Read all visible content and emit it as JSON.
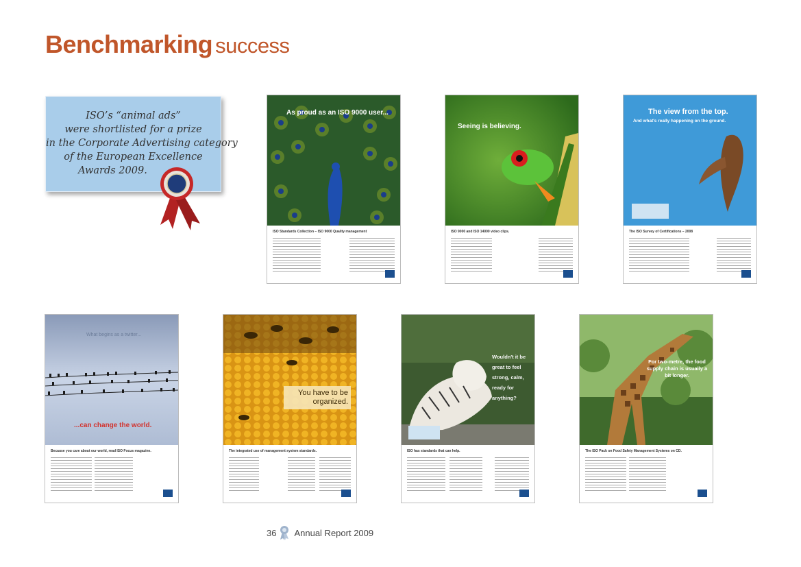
{
  "title": {
    "bold": "Benchmarking",
    "light": "success"
  },
  "note": {
    "lines": [
      "ISO’s “animal ads”",
      "were shortlisted for a prize",
      "in the Corporate Advertising category",
      "of the European Excellence",
      "Awards 2009."
    ]
  },
  "ads": [
    {
      "headline": "As proud as an ISO 9000 user...",
      "caption": "ISO Standards Collection – ISO 9000 Quality management"
    },
    {
      "headline": "Seeing is believing.",
      "caption": "ISO 9000 and ISO 14000 video clips."
    },
    {
      "headline": "The view from the top.",
      "subheadline": "And what's really happening on the ground.",
      "caption": "The ISO Survey of Certifications – 2008"
    },
    {
      "headline": "What begins as a twitter...",
      "subheadline": "...can change the world.",
      "caption": "Because you care about our world, read ISO Focus magazine."
    },
    {
      "headline": "You have to be organized.",
      "caption": "The integrated use of management system standards."
    },
    {
      "headline": "Wouldn't it be great to feel strong, calm, ready for anything?",
      "caption": "ISO has standards that can help."
    },
    {
      "headline": "For two-metre, the food supply chain is usually a bit longer.",
      "caption": "The ISO Pack on Food Safety Management Systems on CD."
    }
  ],
  "footer": {
    "page_number": "36",
    "label": "Annual Report 2009"
  },
  "colors": {
    "title": "#c0562a",
    "note_bg": "#a9cdea",
    "ribbon": "#b22222",
    "iso_blue": "#1b4f8f"
  }
}
